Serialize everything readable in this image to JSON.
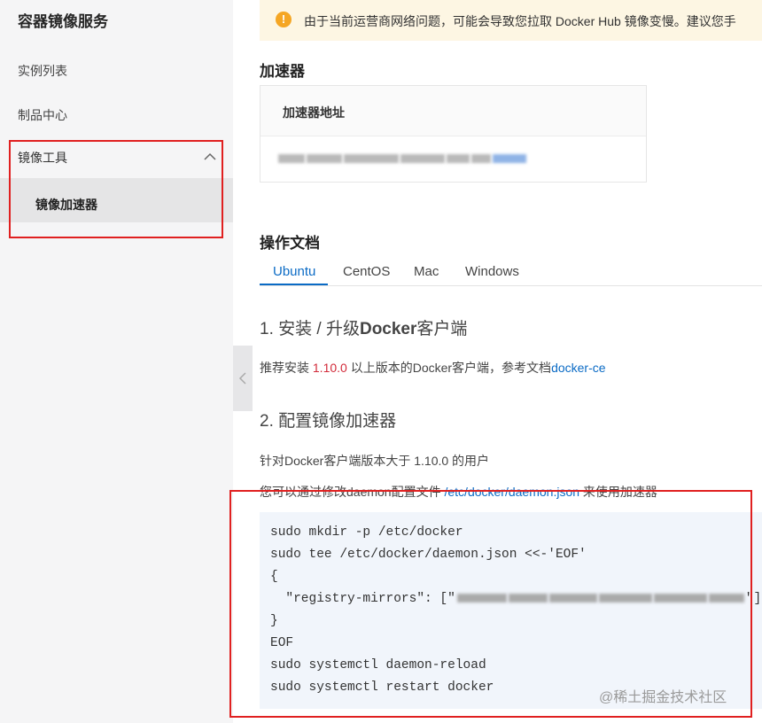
{
  "sidebar": {
    "title": "容器镜像服务",
    "items": [
      {
        "label": "实例列表"
      },
      {
        "label": "制品中心"
      },
      {
        "label": "镜像工具"
      }
    ],
    "sub_items": [
      {
        "label": "镜像加速器",
        "active": true
      }
    ]
  },
  "notice": {
    "icon": "warning-icon",
    "text": "由于当前运营商网络问题，可能会导致您拉取 Docker Hub 镜像变慢。建议您手"
  },
  "accelerator": {
    "heading": "加速器",
    "column_header": "加速器地址",
    "address": "[blurred]"
  },
  "docs": {
    "heading": "操作文档",
    "tabs": [
      "Ubuntu",
      "CentOS",
      "Mac",
      "Windows"
    ],
    "active_tab": "Ubuntu"
  },
  "section1": {
    "title_prefix": "1. 安装 / 升级",
    "title_bold": "Docker",
    "title_suffix": "客户端",
    "text_prefix": "推荐安装 ",
    "version": "1.10.0",
    "text_middle": " 以上版本的Docker客户端，参考文档",
    "link": "docker-ce"
  },
  "section2": {
    "title": "2. 配置镜像加速器",
    "line1": "针对Docker客户端版本大于 1.10.0 的用户",
    "line2_prefix": "您可以通过修改daemon配置文件 ",
    "line2_path": "/etc/docker/daemon.json",
    "line2_suffix": " 来使用加速器"
  },
  "code": {
    "line1": "sudo mkdir -p /etc/docker",
    "line2": "sudo tee /etc/docker/daemon.json <<-'EOF'",
    "line3": "{",
    "line4_prefix": "  \"registry-mirrors\": [\"",
    "line4_suffix": "\"]",
    "line5": "}",
    "line6": "EOF",
    "line7": "sudo systemctl daemon-reload",
    "line8": "sudo systemctl restart docker"
  },
  "watermark": "@稀土掘金技术社区",
  "colors": {
    "accent": "#0b6bc5",
    "warning": "#f5a623",
    "highlight_red": "#e02020",
    "version_red": "#d22b3a"
  }
}
